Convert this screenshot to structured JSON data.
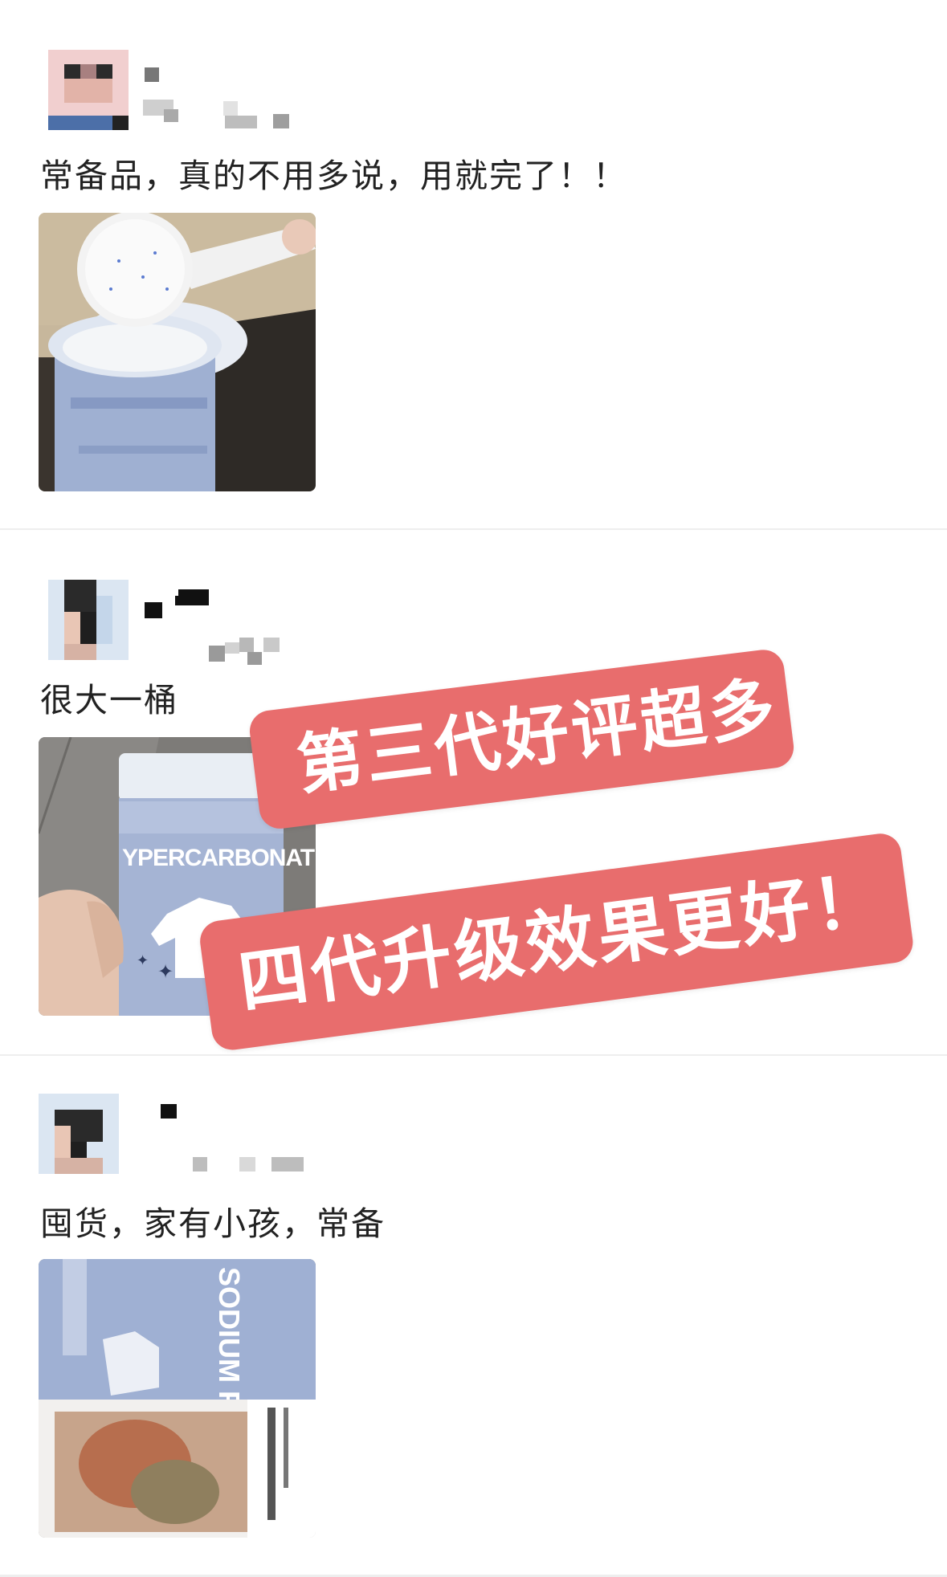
{
  "reviews": [
    {
      "text": "常备品，真的不用多说，用就完了！！"
    },
    {
      "text": "很大一桶"
    },
    {
      "text": "囤货，家有小孩，常备"
    }
  ],
  "overlay": {
    "line1": "第三代好评超多",
    "line2": "四代升级效果更好！"
  },
  "photos": [
    {
      "label": ""
    },
    {
      "label": "YPERCARBONATE"
    },
    {
      "label": "SODIUM PERCARBO"
    }
  ],
  "colors": {
    "banner_bg": "#e86d6d",
    "banner_text": "#ffffff",
    "text": "#222222",
    "divider": "#eeeeee"
  }
}
